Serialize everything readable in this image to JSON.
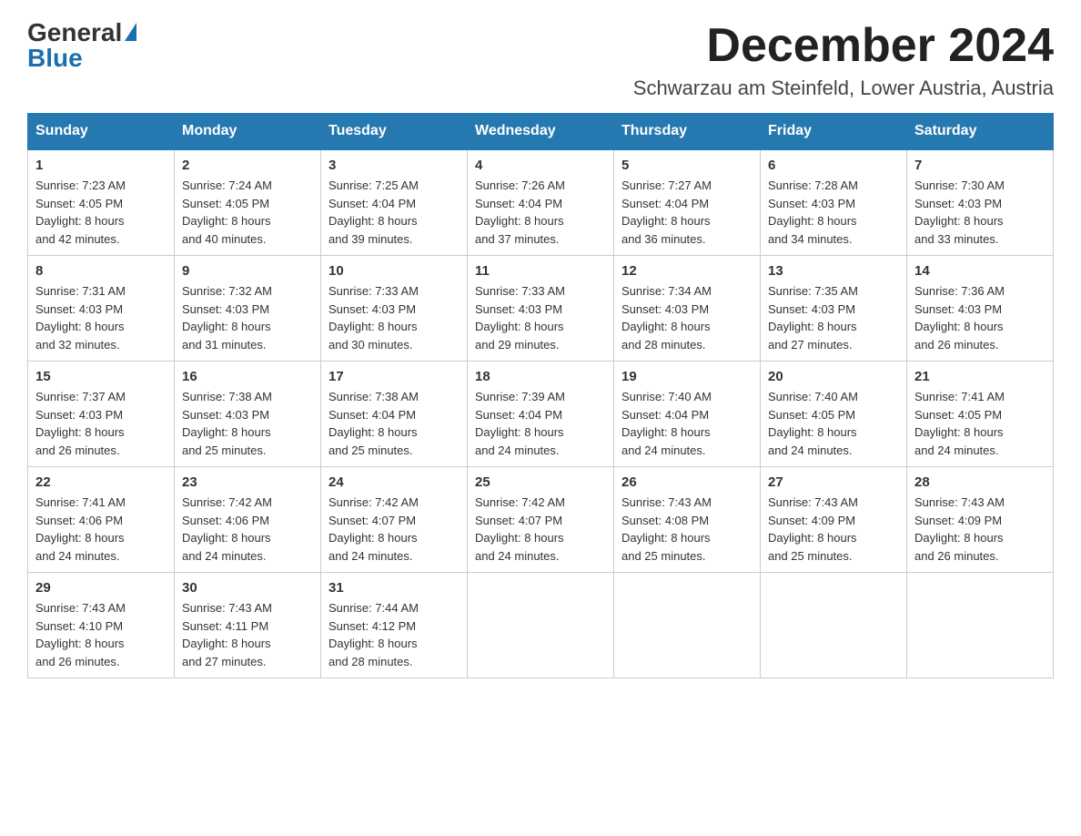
{
  "logo": {
    "general": "General",
    "triangle": "▶",
    "blue": "Blue"
  },
  "title": "December 2024",
  "location": "Schwarzau am Steinfeld, Lower Austria, Austria",
  "days_of_week": [
    "Sunday",
    "Monday",
    "Tuesday",
    "Wednesday",
    "Thursday",
    "Friday",
    "Saturday"
  ],
  "weeks": [
    [
      {
        "day": "1",
        "sunrise": "7:23 AM",
        "sunset": "4:05 PM",
        "daylight": "8 hours and 42 minutes."
      },
      {
        "day": "2",
        "sunrise": "7:24 AM",
        "sunset": "4:05 PM",
        "daylight": "8 hours and 40 minutes."
      },
      {
        "day": "3",
        "sunrise": "7:25 AM",
        "sunset": "4:04 PM",
        "daylight": "8 hours and 39 minutes."
      },
      {
        "day": "4",
        "sunrise": "7:26 AM",
        "sunset": "4:04 PM",
        "daylight": "8 hours and 37 minutes."
      },
      {
        "day": "5",
        "sunrise": "7:27 AM",
        "sunset": "4:04 PM",
        "daylight": "8 hours and 36 minutes."
      },
      {
        "day": "6",
        "sunrise": "7:28 AM",
        "sunset": "4:03 PM",
        "daylight": "8 hours and 34 minutes."
      },
      {
        "day": "7",
        "sunrise": "7:30 AM",
        "sunset": "4:03 PM",
        "daylight": "8 hours and 33 minutes."
      }
    ],
    [
      {
        "day": "8",
        "sunrise": "7:31 AM",
        "sunset": "4:03 PM",
        "daylight": "8 hours and 32 minutes."
      },
      {
        "day": "9",
        "sunrise": "7:32 AM",
        "sunset": "4:03 PM",
        "daylight": "8 hours and 31 minutes."
      },
      {
        "day": "10",
        "sunrise": "7:33 AM",
        "sunset": "4:03 PM",
        "daylight": "8 hours and 30 minutes."
      },
      {
        "day": "11",
        "sunrise": "7:33 AM",
        "sunset": "4:03 PM",
        "daylight": "8 hours and 29 minutes."
      },
      {
        "day": "12",
        "sunrise": "7:34 AM",
        "sunset": "4:03 PM",
        "daylight": "8 hours and 28 minutes."
      },
      {
        "day": "13",
        "sunrise": "7:35 AM",
        "sunset": "4:03 PM",
        "daylight": "8 hours and 27 minutes."
      },
      {
        "day": "14",
        "sunrise": "7:36 AM",
        "sunset": "4:03 PM",
        "daylight": "8 hours and 26 minutes."
      }
    ],
    [
      {
        "day": "15",
        "sunrise": "7:37 AM",
        "sunset": "4:03 PM",
        "daylight": "8 hours and 26 minutes."
      },
      {
        "day": "16",
        "sunrise": "7:38 AM",
        "sunset": "4:03 PM",
        "daylight": "8 hours and 25 minutes."
      },
      {
        "day": "17",
        "sunrise": "7:38 AM",
        "sunset": "4:04 PM",
        "daylight": "8 hours and 25 minutes."
      },
      {
        "day": "18",
        "sunrise": "7:39 AM",
        "sunset": "4:04 PM",
        "daylight": "8 hours and 24 minutes."
      },
      {
        "day": "19",
        "sunrise": "7:40 AM",
        "sunset": "4:04 PM",
        "daylight": "8 hours and 24 minutes."
      },
      {
        "day": "20",
        "sunrise": "7:40 AM",
        "sunset": "4:05 PM",
        "daylight": "8 hours and 24 minutes."
      },
      {
        "day": "21",
        "sunrise": "7:41 AM",
        "sunset": "4:05 PM",
        "daylight": "8 hours and 24 minutes."
      }
    ],
    [
      {
        "day": "22",
        "sunrise": "7:41 AM",
        "sunset": "4:06 PM",
        "daylight": "8 hours and 24 minutes."
      },
      {
        "day": "23",
        "sunrise": "7:42 AM",
        "sunset": "4:06 PM",
        "daylight": "8 hours and 24 minutes."
      },
      {
        "day": "24",
        "sunrise": "7:42 AM",
        "sunset": "4:07 PM",
        "daylight": "8 hours and 24 minutes."
      },
      {
        "day": "25",
        "sunrise": "7:42 AM",
        "sunset": "4:07 PM",
        "daylight": "8 hours and 24 minutes."
      },
      {
        "day": "26",
        "sunrise": "7:43 AM",
        "sunset": "4:08 PM",
        "daylight": "8 hours and 25 minutes."
      },
      {
        "day": "27",
        "sunrise": "7:43 AM",
        "sunset": "4:09 PM",
        "daylight": "8 hours and 25 minutes."
      },
      {
        "day": "28",
        "sunrise": "7:43 AM",
        "sunset": "4:09 PM",
        "daylight": "8 hours and 26 minutes."
      }
    ],
    [
      {
        "day": "29",
        "sunrise": "7:43 AM",
        "sunset": "4:10 PM",
        "daylight": "8 hours and 26 minutes."
      },
      {
        "day": "30",
        "sunrise": "7:43 AM",
        "sunset": "4:11 PM",
        "daylight": "8 hours and 27 minutes."
      },
      {
        "day": "31",
        "sunrise": "7:44 AM",
        "sunset": "4:12 PM",
        "daylight": "8 hours and 28 minutes."
      },
      null,
      null,
      null,
      null
    ]
  ],
  "labels": {
    "sunrise": "Sunrise:",
    "sunset": "Sunset:",
    "daylight": "Daylight:"
  }
}
